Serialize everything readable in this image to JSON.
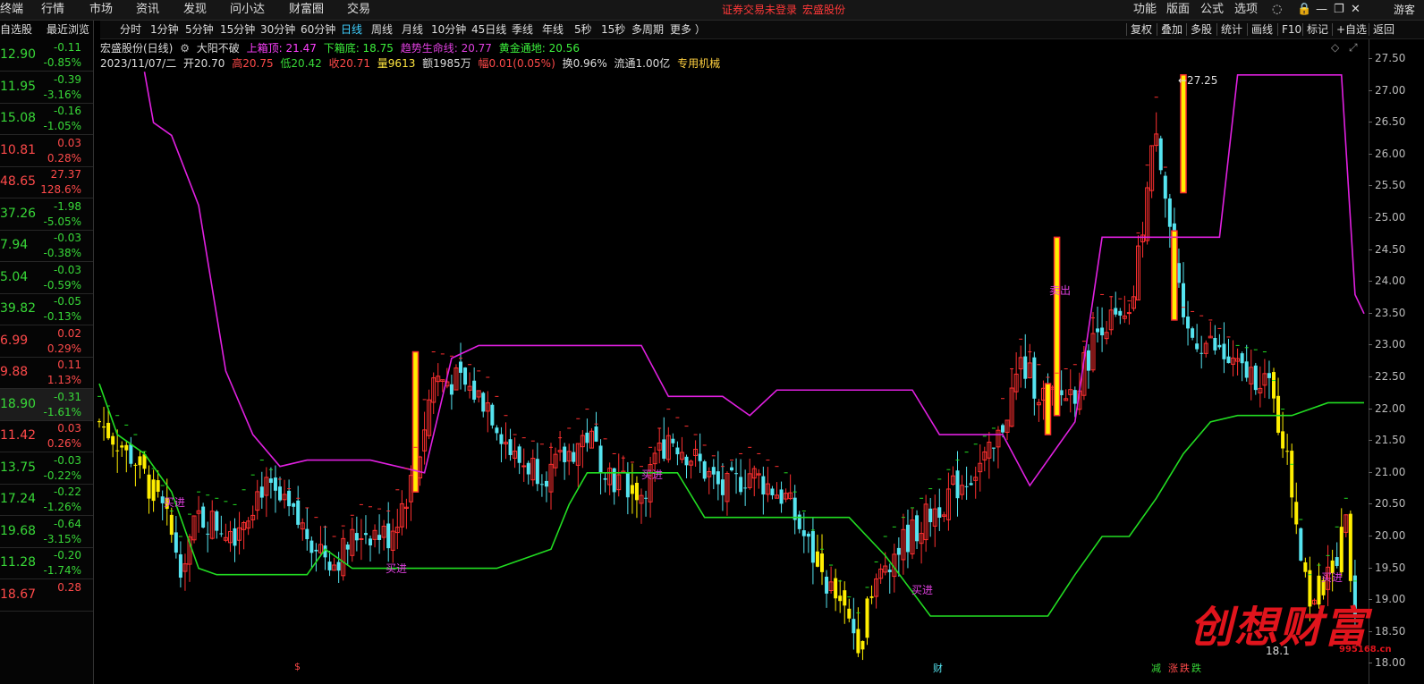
{
  "top_menu": [
    "终端",
    "行情",
    "市场",
    "资讯",
    "发现",
    "问小达",
    "财富圈",
    "交易"
  ],
  "notice": {
    "login": "证券交易未登录",
    "stock": "宏盛股份"
  },
  "right_menu": [
    "功能",
    "版面",
    "公式",
    "选项"
  ],
  "user_label": "游客",
  "timeframes": [
    "分时",
    "1分钟",
    "5分钟",
    "15分钟",
    "30分钟",
    "60分钟",
    "日线",
    "周线",
    "月线",
    "10分钟",
    "45日线",
    "季线",
    "年线",
    "5秒",
    "15秒",
    "多周期",
    "更多 ）"
  ],
  "active_timeframe": "日线",
  "tool_buttons": [
    "复权",
    "叠加",
    "多股",
    "统计",
    "画线",
    "F10",
    "标记",
    "+自选",
    "返回"
  ],
  "left_panel": {
    "header_left": "自选股",
    "header_right": "最近浏览",
    "rows": [
      {
        "price": "12.90",
        "chg": "-0.11",
        "pct": "-0.85%",
        "dir": "dn"
      },
      {
        "price": "11.95",
        "chg": "-0.39",
        "pct": "-3.16%",
        "dir": "dn"
      },
      {
        "price": "15.08",
        "chg": "-0.16",
        "pct": "-1.05%",
        "dir": "dn"
      },
      {
        "price": "10.81",
        "chg": "0.03",
        "pct": "0.28%",
        "dir": "up"
      },
      {
        "price": "48.65",
        "chg": "27.37",
        "pct": "128.6%",
        "dir": "up"
      },
      {
        "price": "37.26",
        "chg": "-1.98",
        "pct": "-5.05%",
        "dir": "dn"
      },
      {
        "price": "7.94",
        "chg": "-0.03",
        "pct": "-0.38%",
        "dir": "dn"
      },
      {
        "price": "5.04",
        "chg": "-0.03",
        "pct": "-0.59%",
        "dir": "dn"
      },
      {
        "price": "39.82",
        "chg": "-0.05",
        "pct": "-0.13%",
        "dir": "dn"
      },
      {
        "price": "6.99",
        "chg": "0.02",
        "pct": "0.29%",
        "dir": "up"
      },
      {
        "price": "9.88",
        "chg": "0.11",
        "pct": "1.13%",
        "dir": "up"
      },
      {
        "price": "18.90",
        "chg": "-0.31",
        "pct": "-1.61%",
        "dir": "dn",
        "selected": true
      },
      {
        "price": "11.42",
        "chg": "0.03",
        "pct": "0.26%",
        "dir": "up"
      },
      {
        "price": "13.75",
        "chg": "-0.03",
        "pct": "-0.22%",
        "dir": "dn"
      },
      {
        "price": "17.24",
        "chg": "-0.22",
        "pct": "-1.26%",
        "dir": "dn"
      },
      {
        "price": "19.68",
        "chg": "-0.64",
        "pct": "-3.15%",
        "dir": "dn"
      },
      {
        "price": "11.28",
        "chg": "-0.20",
        "pct": "-1.74%",
        "dir": "dn"
      },
      {
        "price": "18.67",
        "chg": "0.28",
        "pct": "",
        "dir": "up"
      }
    ]
  },
  "info_line1": {
    "stock": "宏盛股份(日线)",
    "indicator": "大阳不破",
    "upper_label": "上箱顶: 21.47",
    "lower_label": "下箱底: 18.75",
    "trend_label": "趋势生命线: 20.77",
    "gold_label": "黄金通地: 20.56"
  },
  "info_line2": {
    "date": "2023/11/07/二",
    "open": "开20.70",
    "high": "高20.75",
    "low": "低20.42",
    "close": "收20.71",
    "vol": "量9613",
    "amount": "额1985万",
    "amp": "幅0.01(0.05%)",
    "turnover": "换0.96%",
    "float": "流通1.00亿",
    "sector": "专用机械"
  },
  "y_ticks": [
    "27.50",
    "27.00",
    "26.50",
    "26.00",
    "25.50",
    "25.00",
    "24.50",
    "24.00",
    "23.50",
    "23.00",
    "22.50",
    "22.00",
    "21.50",
    "21.00",
    "20.50",
    "20.00",
    "19.50",
    "19.00",
    "18.50",
    "18.00"
  ],
  "chart_labels": {
    "max_label": "27.25",
    "min_label": "18.1",
    "buy": "买进",
    "sell": "卖出",
    "bottom_s": "$",
    "bottom_cai": "财",
    "bottom_jian": "减",
    "bottom_zhang": "涨",
    "bottom_die": "跌",
    "bottom_die2": "跌"
  },
  "watermark": {
    "text": "创想财富",
    "url": "995168.cn"
  },
  "colors": {
    "up": "#ff4a4a",
    "down": "#38d838",
    "cyan": "#55e4f0",
    "yellow": "#ffee00",
    "magenta": "#e020e0",
    "green": "#22dd22",
    "trend": "#22dd22"
  }
}
